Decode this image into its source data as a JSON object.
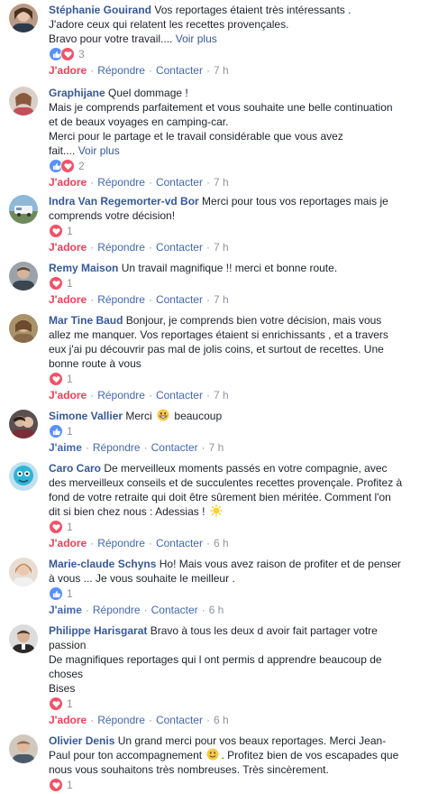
{
  "labels": {
    "love": "J'adore",
    "like": "J'aime",
    "reply": "Répondre",
    "contact": "Contacter",
    "see_more": "Voir plus",
    "sep": "·"
  },
  "colors": {
    "name": "#365899",
    "love": "#f33e58",
    "like": "#4267b2",
    "meta": "#90949c"
  },
  "comments": [
    {
      "author": "Stéphanie Gouirand",
      "lines": [
        " Vos reportages étaient très intéressants .",
        "J'adore ceux qui relatent les recettes provençales.",
        "Bravo pour votre travail...."
      ],
      "reactions": [
        "like",
        "love"
      ],
      "count": "3",
      "action": "J'adore",
      "time": "7 h"
    },
    {
      "author": "Graphijane",
      "lines": [
        " Quel dommage !",
        "Mais je comprends parfaitement et vous souhaite une belle continuation",
        "et de beaux voyages en camping-car.",
        "Merci pour le partage et le travail considérable que vous avez",
        "fait...."
      ],
      "reactions": [
        "like",
        "love"
      ],
      "count": "2",
      "action": "J'adore",
      "time": "7 h"
    },
    {
      "author": "Indra Van Regemorter-vd Bor",
      "lines": [
        " Merci pour tous vos reportages mais je",
        "comprends votre décision!"
      ],
      "reactions": [
        "love"
      ],
      "count": "1",
      "action": "J'adore",
      "time": "7 h"
    },
    {
      "author": "Remy Maison",
      "lines": [
        " Un travail magnifique !! merci et bonne route."
      ],
      "reactions": [
        "love"
      ],
      "count": "1",
      "action": "J'adore",
      "time": "7 h"
    },
    {
      "author": "Mar Tine Baud",
      "lines": [
        " Bonjour, je comprends bien votre décision, mais vous",
        "allez me manquer. Vos reportages étaient si enrichissants , et a travers",
        "eux j'ai pu découvrir pas mal de jolis coins, et surtout de recettes. Une",
        "bonne route à vous"
      ],
      "reactions": [
        "love"
      ],
      "count": "1",
      "action": "J'adore",
      "time": "7 h"
    },
    {
      "author": "Simone Vallier",
      "lines": [
        " Merci",
        " beaucoup"
      ],
      "reactions": [
        "like"
      ],
      "count": "1",
      "action": "J'aime",
      "time": "7 h"
    },
    {
      "author": "Caro Caro",
      "lines": [
        " De merveilleux moments passés en votre compagnie, avec",
        "des merveilleux conseils et de succulentes recettes provençale. Profitez à",
        "fond de votre retraite qui doit être sûrement bien méritée. Comment l'on",
        "dit si bien chez nous : Adessias !"
      ],
      "reactions": [
        "love"
      ],
      "count": "1",
      "action": "J'adore",
      "time": "6 h"
    },
    {
      "author": "Marie-claude Schyns",
      "lines": [
        " Ho! Mais vous avez raison de profiter et de penser",
        "à vous ... Je vous souhaite le meilleur ."
      ],
      "reactions": [
        "like"
      ],
      "count": "1",
      "action": "J'aime",
      "time": "6 h"
    },
    {
      "author": "Philippe Harisgarat",
      "lines": [
        " Bravo à tous les deux d avoir fait partager votre",
        "passion",
        "De magnifiques reportages qui l ont permis d apprendre beaucoup de",
        "choses",
        "Bises"
      ],
      "reactions": [
        "love"
      ],
      "count": "1",
      "action": "J'adore",
      "time": "6 h"
    },
    {
      "author": "Olivier Denis",
      "lines": [
        " Un grand merci pour vos beaux reportages. Merci Jean-",
        "Paul pour ton accompagnement",
        ". Profitez bien de vos escapades que",
        "nous vous souhaitons très nombreuses. Très sincèrement."
      ],
      "reactions": [
        "love"
      ],
      "count": "1",
      "action": "",
      "time": ""
    }
  ]
}
